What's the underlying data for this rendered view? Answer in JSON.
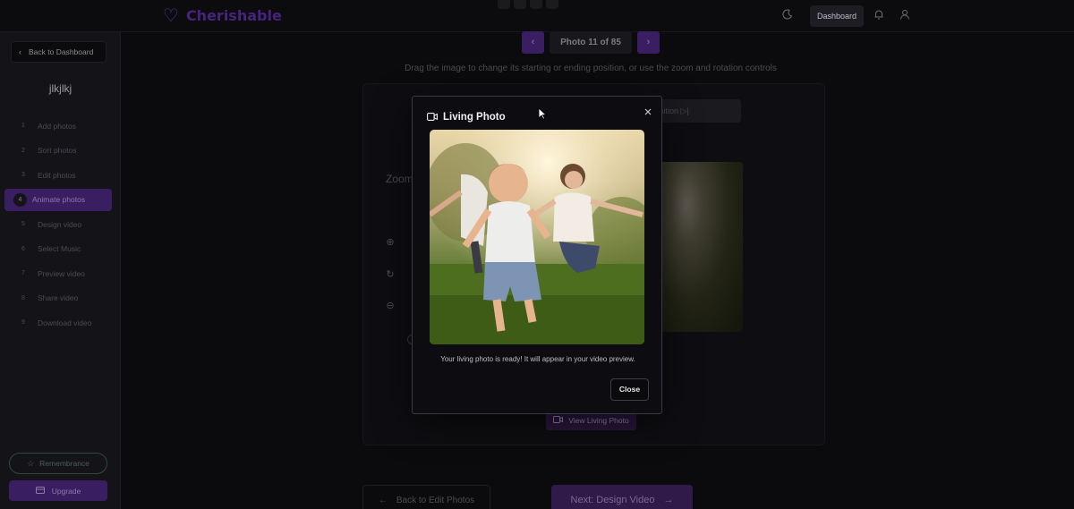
{
  "app": {
    "name": "Cherishable"
  },
  "header": {
    "top_tabs": [
      "",
      "",
      "",
      ""
    ],
    "dashboard_label": "Dashboard"
  },
  "sidebar": {
    "back_label": "Back to Dashboard",
    "project_name": "jlkjlkj",
    "steps": [
      {
        "num": "1",
        "label": "Add photos"
      },
      {
        "num": "2",
        "label": "Sort photos"
      },
      {
        "num": "3",
        "label": "Edit photos"
      },
      {
        "num": "4",
        "label": "Animate photos",
        "active": true
      },
      {
        "num": "5",
        "label": "Design video"
      },
      {
        "num": "6",
        "label": "Select Music"
      },
      {
        "num": "7",
        "label": "Preview video"
      },
      {
        "num": "8",
        "label": "Share video"
      },
      {
        "num": "9",
        "label": "Download video"
      }
    ],
    "remembrance_label": "Remembrance",
    "upgrade_label": "Upgrade"
  },
  "main": {
    "photo_counter": "Photo 11 of 85",
    "instruction": "Drag the image to change its starting or ending position, or use the zoom and rotation controls",
    "end_position_label": "osition",
    "zoom_label": "Zoom",
    "view_living_label": "View Living Photo",
    "back_button": "Back to Edit Photos",
    "next_button": "Next: Design Video"
  },
  "modal": {
    "title": "Living Photo",
    "message": "Your living photo is ready! It will appear in your video preview.",
    "close_label": "Close"
  },
  "colors": {
    "accent": "#3a1e62",
    "brand": "#5b2ea6",
    "background": "#0b0b0e"
  },
  "icons": [
    "heart-icon",
    "moon-icon",
    "bell-icon",
    "user-icon",
    "chevron-left-icon",
    "chevron-right-icon",
    "video-icon",
    "close-icon",
    "zoom-in-icon",
    "rotate-icon",
    "zoom-out-icon",
    "star-icon",
    "card-icon",
    "arrow-left-icon",
    "arrow-right-icon"
  ]
}
